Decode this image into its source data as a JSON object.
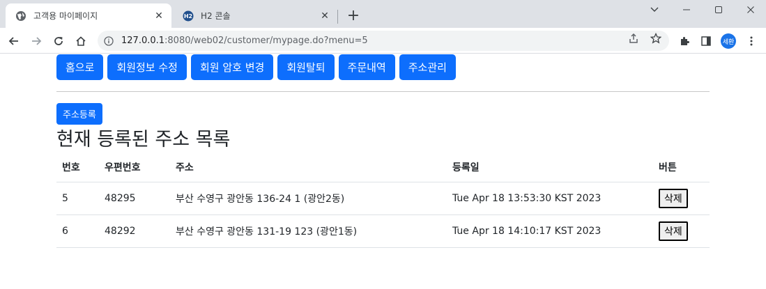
{
  "browser": {
    "tabs": [
      {
        "title": "고객용 마이페이지",
        "active": true
      },
      {
        "title": "H2 콘솔",
        "active": false
      }
    ],
    "url_host": "127.0.0.1",
    "url_rest": ":8080/web02/customer/mypage.do?menu=5",
    "profile_initials": "세환"
  },
  "menu": {
    "items": [
      "홈으로",
      "회원정보 수정",
      "회원 암호 변경",
      "회원탈퇴",
      "주문내역",
      "주소관리"
    ]
  },
  "register_button": "주소등록",
  "heading": "현재 등록된 주소 목록",
  "table": {
    "headers": [
      "번호",
      "우편번호",
      "주소",
      "등록일",
      "버튼"
    ],
    "rows": [
      {
        "no": "5",
        "zip": "48295",
        "address": "부산 수영구 광안동 136-24 1 (광안2동)",
        "date": "Tue Apr 18 13:53:30 KST 2023",
        "button": "삭제"
      },
      {
        "no": "6",
        "zip": "48292",
        "address": "부산 수영구 광안동 131-19 123 (광안1동)",
        "date": "Tue Apr 18 14:10:17 KST 2023",
        "button": "삭제"
      }
    ]
  },
  "colors": {
    "primary": "#0d6efd",
    "chrome": "#dee1e6"
  }
}
